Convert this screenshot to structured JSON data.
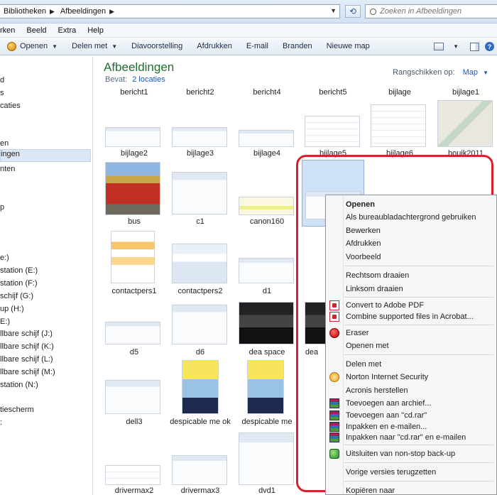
{
  "address": {
    "crumbs": [
      "Bibliotheken",
      "Afbeeldingen"
    ],
    "search_placeholder": "Zoeken in Afbeeldingen"
  },
  "menubar": [
    "rken",
    "Beeld",
    "Extra",
    "Help"
  ],
  "toolbar": {
    "open": "Openen",
    "share": "Delen met",
    "slideshow": "Diavoorstelling",
    "print": "Afdrukken",
    "email": "E-mail",
    "burn": "Branden",
    "new_folder": "Nieuwe map"
  },
  "sidebar": {
    "items": [
      "d",
      "s",
      "caties",
      "en",
      "ingen",
      "nten",
      "p",
      "e:)",
      "station (E:)",
      "station (F:)",
      "schijf (G:)",
      "up (H:)",
      "E:)",
      "llbare schijf (J:)",
      "llbare schijf (K:)",
      "llbare schijf (L:)",
      "llbare schijf (M:)",
      "station (N:)",
      "tiescherm",
      ":"
    ],
    "selected_index": 4
  },
  "library": {
    "title": "Afbeeldingen",
    "includes_label": "Bevat:",
    "locations_link": "2 locaties",
    "arrange_label": "Rangschikken op:",
    "arrange_value": "Map"
  },
  "files": [
    {
      "name": "bericht1"
    },
    {
      "name": "bericht2"
    },
    {
      "name": "bericht4"
    },
    {
      "name": "bericht5"
    },
    {
      "name": "bijlage"
    },
    {
      "name": "bijlage1"
    },
    {
      "name": "bijlage2"
    },
    {
      "name": "bijlage3"
    },
    {
      "name": "bijlage4"
    },
    {
      "name": "bijlage5"
    },
    {
      "name": "bijlage6"
    },
    {
      "name": "bouik2011"
    },
    {
      "name": "bus"
    },
    {
      "name": "c1"
    },
    {
      "name": "canon160"
    },
    {
      "name": "contactpers1"
    },
    {
      "name": "contactpers2"
    },
    {
      "name": "d1"
    },
    {
      "name": "d5"
    },
    {
      "name": "d6"
    },
    {
      "name": "dea space"
    },
    {
      "name": "dea"
    },
    {
      "name": "dell3"
    },
    {
      "name": "despicable me ok"
    },
    {
      "name": "despicable me"
    },
    {
      "name": "drivermax2"
    },
    {
      "name": "drivermax3"
    },
    {
      "name": "dvd1"
    }
  ],
  "context_menu": {
    "items": [
      {
        "label": "Openen",
        "bold": true
      },
      {
        "label": "Als bureaubladachtergrond gebruiken"
      },
      {
        "label": "Bewerken"
      },
      {
        "label": "Afdrukken"
      },
      {
        "label": "Voorbeeld"
      },
      {
        "label": "Rechtsom draaien"
      },
      {
        "label": "Linksom draaien"
      },
      {
        "label": "Convert to Adobe PDF",
        "icon": "adobe-pdf-icon"
      },
      {
        "label": "Combine supported files in Acrobat...",
        "icon": "acrobat-combine-icon"
      },
      {
        "label": "Eraser",
        "icon": "eraser-icon"
      },
      {
        "label": "Openen met"
      },
      {
        "label": "Delen met"
      },
      {
        "label": "Norton Internet Security",
        "icon": "norton-icon"
      },
      {
        "label": "Acronis herstellen"
      },
      {
        "label": "Toevoegen aan archief...",
        "icon": "winrar-icon"
      },
      {
        "label": "Toevoegen aan \"cd.rar\"",
        "icon": "winrar-icon"
      },
      {
        "label": "Inpakken en e-mailen...",
        "icon": "winrar-icon"
      },
      {
        "label": "Inpakken naar \"cd.rar\" en e-mailen",
        "icon": "winrar-icon"
      },
      {
        "label": "Uitsluiten van non-stop back-up",
        "icon": "backup-icon"
      },
      {
        "label": "Vorige versies terugzetten"
      },
      {
        "label": "Kopiëren naar"
      }
    ]
  },
  "colors": {
    "library_title": "#1e6f2f",
    "link": "#1a57b8",
    "highlight_outline": "#d6222e"
  }
}
